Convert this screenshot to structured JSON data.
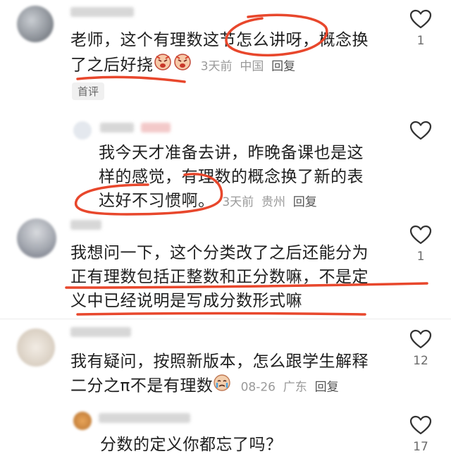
{
  "comments": [
    {
      "text_lines": [
        "老师，这个有理数这节怎么讲呀，概念换",
        "了之后好挠"
      ],
      "meta": {
        "time": "3天前",
        "location": "中国",
        "reply": "回复"
      },
      "tag": "首评",
      "likes": "1",
      "reply_item": {
        "text_lines": [
          "我今天才准备去讲，昨晚备课也是这",
          "样的感觉，有理数的概念换了新的表",
          "达好不习惯啊。"
        ],
        "meta": {
          "time": "3天前",
          "location": "贵州",
          "reply": "回复"
        },
        "likes": ""
      }
    },
    {
      "text_lines": [
        "我想问一下，这个分类改了之后还能分为",
        "正有理数包括正整数和正分数嘛，不是定",
        "义中已经说明是写成分数形式嘛"
      ],
      "likes": "1"
    },
    {
      "text_lines": [
        "我有疑问，按照新版本，怎么跟学生解释",
        "二分之π不是有理数"
      ],
      "meta": {
        "time": "08-26",
        "location": "广东",
        "reply": "回复"
      },
      "likes": "12",
      "reply_item": {
        "text_lines": [
          "分数的定义你都忘了吗？"
        ],
        "likes": "17"
      }
    }
  ],
  "colors": {
    "annotation": "#e8472c",
    "meta": "#9a9a9a"
  }
}
